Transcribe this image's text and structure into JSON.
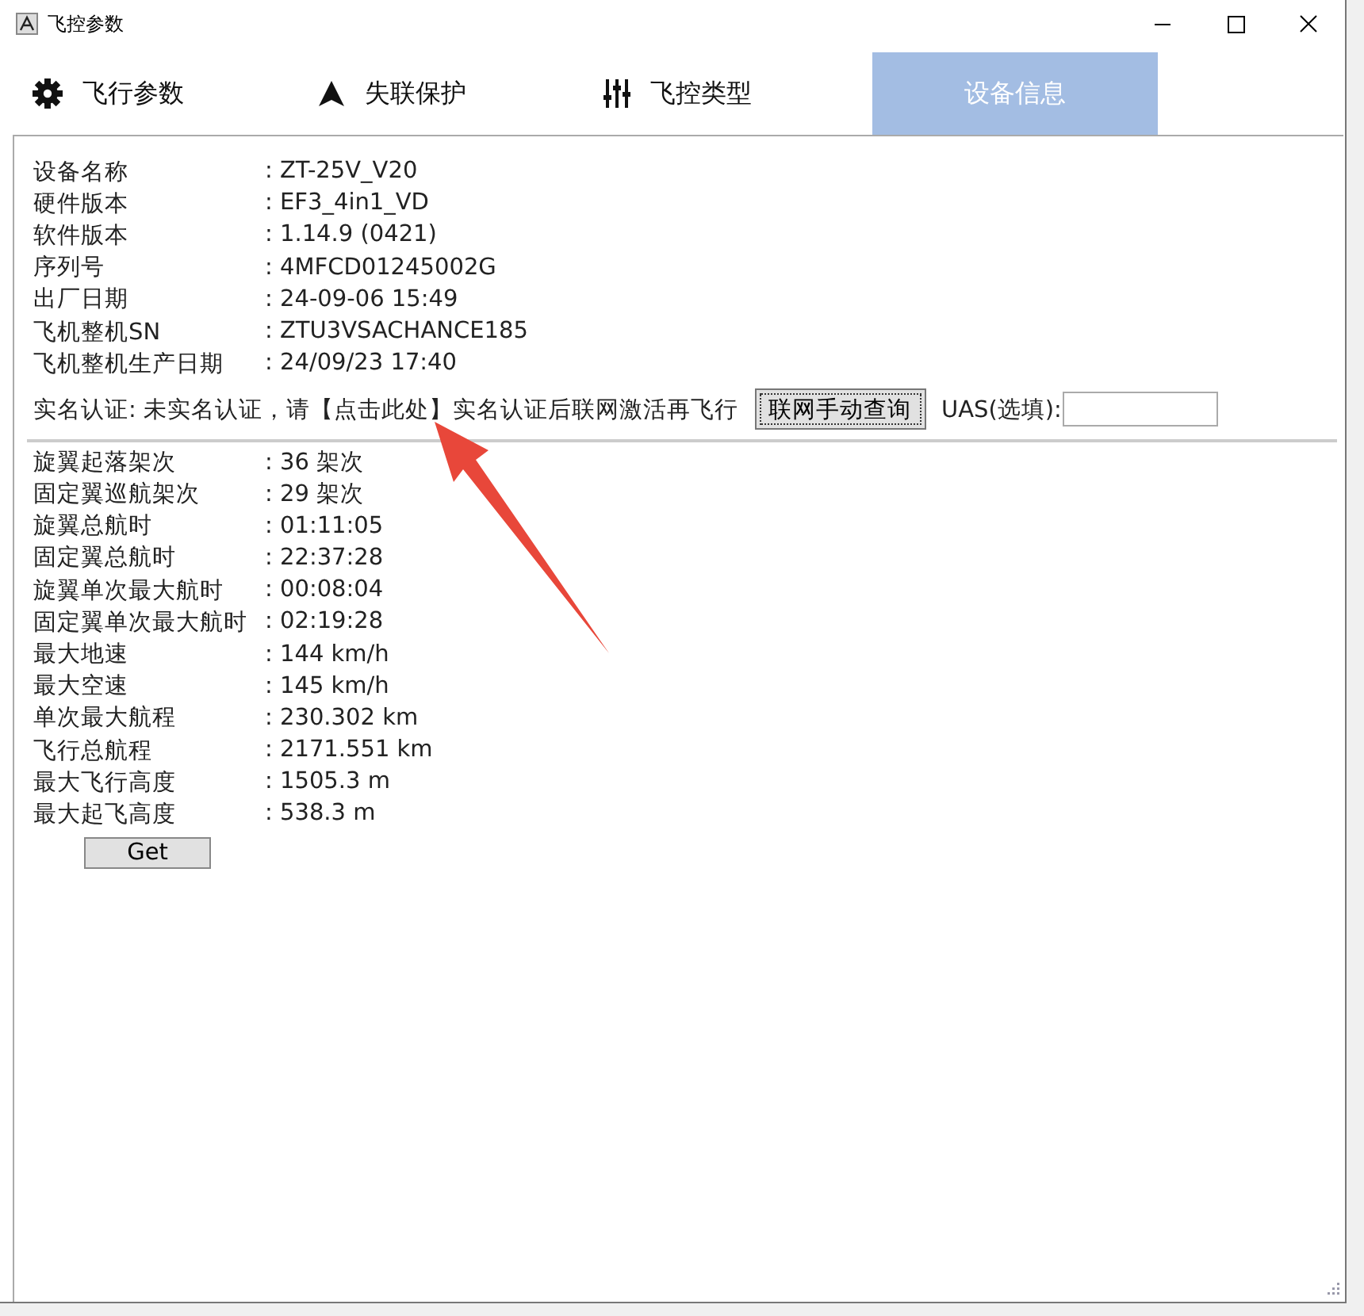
{
  "window": {
    "title": "飞控参数"
  },
  "tabs": [
    {
      "label": "飞行参数",
      "selected": false
    },
    {
      "label": "失联保护",
      "selected": false
    },
    {
      "label": "飞控类型",
      "selected": false
    },
    {
      "label": "设备信息",
      "selected": true
    }
  ],
  "device_info": [
    {
      "label": "设备名称",
      "value": ": ZT-25V_V20"
    },
    {
      "label": "硬件版本",
      "value": ": EF3_4in1_VD"
    },
    {
      "label": "软件版本",
      "value": ": 1.14.9 (0421)"
    },
    {
      "label": "序列号",
      "value": ": 4MFCD01245002G"
    },
    {
      "label": "出厂日期",
      "value": ": 24-09-06 15:49"
    },
    {
      "label": "飞机整机SN",
      "value": ": ZTU3VSACHANCE185"
    },
    {
      "label": "飞机整机生产日期",
      "value": ": 24/09/23 17:40"
    }
  ],
  "verification": {
    "text": "实名认证: 未实名认证，请【点击此处】实名认证后联网激活再飞行",
    "button": "联网手动查询",
    "uas_label": "UAS(选填):"
  },
  "flight_stats": [
    {
      "label": "旋翼起落架次",
      "value": ": 36 架次"
    },
    {
      "label": "固定翼巡航架次",
      "value": ": 29 架次"
    },
    {
      "label": "旋翼总航时",
      "value": ": 01:11:05"
    },
    {
      "label": "固定翼总航时",
      "value": ": 22:37:28"
    },
    {
      "label": "旋翼单次最大航时",
      "value": ": 00:08:04"
    },
    {
      "label": "固定翼单次最大航时",
      "value": ": 02:19:28"
    },
    {
      "label": "最大地速",
      "value": ": 144 km/h"
    },
    {
      "label": "最大空速",
      "value": ": 145 km/h"
    },
    {
      "label": "单次最大航程",
      "value": ": 230.302 km"
    },
    {
      "label": "飞行总航程",
      "value": ": 2171.551 km"
    },
    {
      "label": "最大飞行高度",
      "value": ": 1505.3 m"
    },
    {
      "label": "最大起飞高度",
      "value": ": 538.3 m"
    }
  ],
  "get_button": "Get"
}
